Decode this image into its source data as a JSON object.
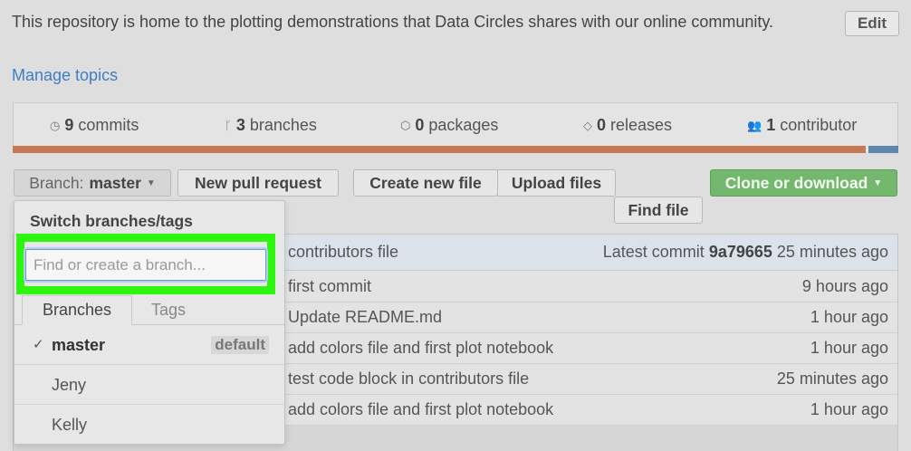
{
  "repo": {
    "description": "This repository is home to the plotting demonstrations that Data Circles shares with our online community.",
    "edit_label": "Edit",
    "manage_topics": "Manage topics"
  },
  "stats": {
    "commits_count": "9",
    "commits_label": "commits",
    "branches_count": "3",
    "branches_label": "branches",
    "packages_count": "0",
    "packages_label": "packages",
    "releases_count": "0",
    "releases_label": "releases",
    "contributors_count": "1",
    "contributors_label": "contributor"
  },
  "colors": {
    "lang_primary": "#c57a55",
    "lang_secondary": "#5d87ad",
    "clone_green": "#73b86d",
    "highlight": "#2cf60d"
  },
  "toolbar": {
    "branch_prefix": "Branch:",
    "branch_name": "master",
    "new_pull_request": "New pull request",
    "create_new_file": "Create new file",
    "upload_files": "Upload files",
    "find_file": "Find file",
    "clone_or_download": "Clone or download"
  },
  "latest_commit": {
    "message": "contributors file",
    "label": "Latest commit",
    "hash": "9a79665",
    "age": "25 minutes ago"
  },
  "files": [
    {
      "message": "first commit",
      "age": "9 hours ago"
    },
    {
      "message": "Update README.md",
      "age": "1 hour ago"
    },
    {
      "message": "add colors file and first plot notebook",
      "age": "1 hour ago"
    },
    {
      "message": "test code block in contributors file",
      "age": "25 minutes ago"
    },
    {
      "message": "add colors file and first plot notebook",
      "age": "1 hour ago"
    }
  ],
  "branch_dropdown": {
    "title": "Switch branches/tags",
    "search_placeholder": "Find or create a branch...",
    "search_value": "",
    "tab_branches": "Branches",
    "tab_tags": "Tags",
    "branches": [
      {
        "name": "master",
        "badge": "default",
        "selected": true
      },
      {
        "name": "Jeny"
      },
      {
        "name": "Kelly"
      }
    ]
  }
}
